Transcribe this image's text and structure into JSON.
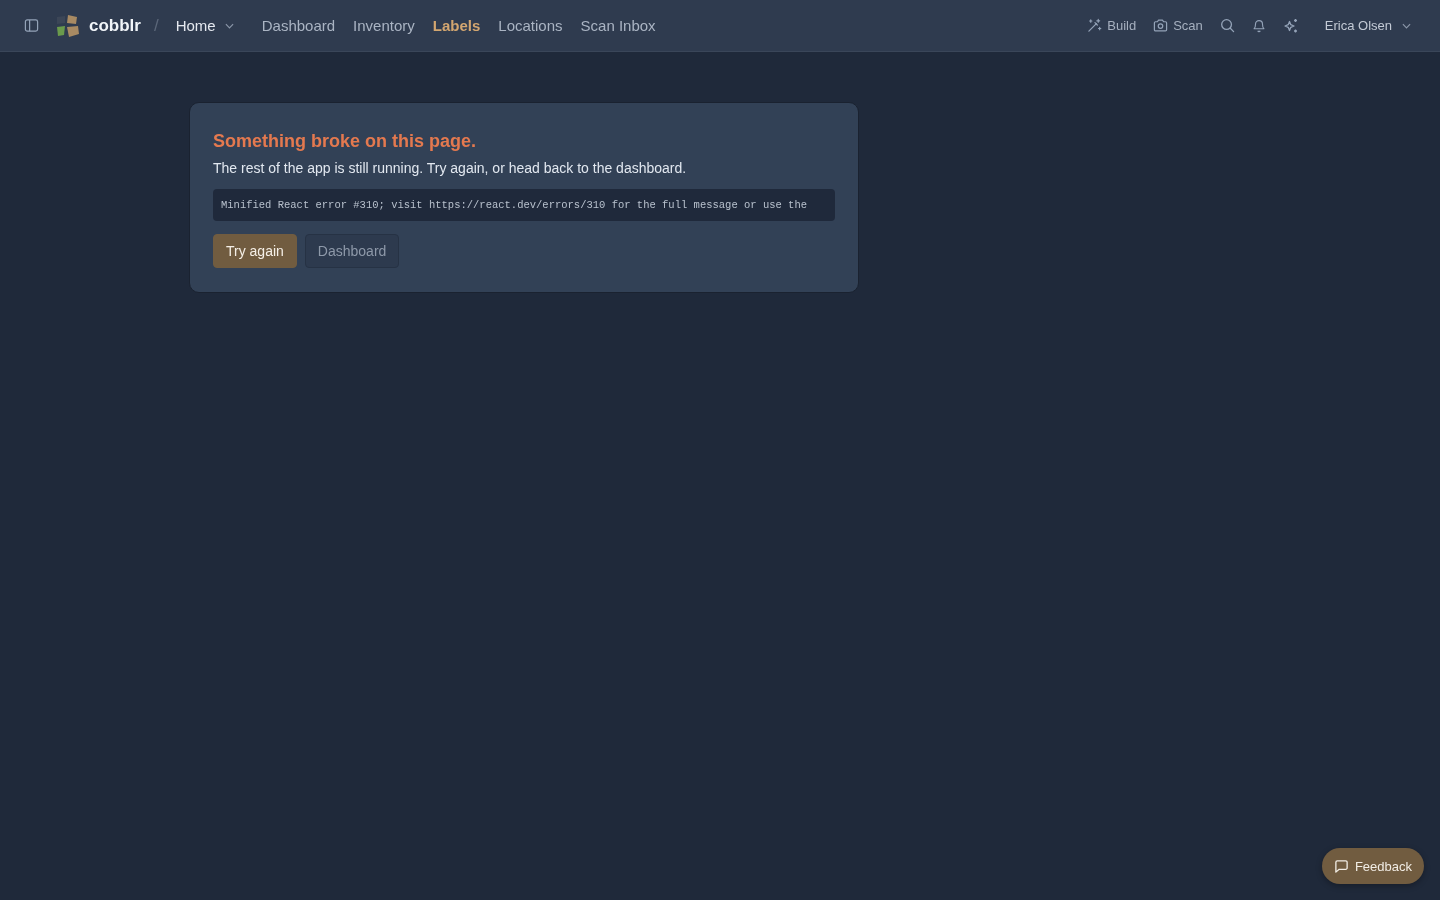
{
  "top_bar": {
    "brand": "cobblr",
    "separator": "/",
    "breadcrumb": {
      "label": "Home"
    },
    "nav": [
      {
        "label": "Dashboard",
        "selected": false
      },
      {
        "label": "Inventory",
        "selected": false
      },
      {
        "label": "Labels",
        "selected": true
      },
      {
        "label": "Locations",
        "selected": false
      },
      {
        "label": "Scan Inbox",
        "selected": false
      }
    ],
    "actions": [
      {
        "kind": "wand",
        "label": "Build"
      },
      {
        "kind": "camera",
        "label": "Scan"
      },
      {
        "kind": "search"
      },
      {
        "kind": "bell"
      },
      {
        "kind": "sparkle"
      }
    ],
    "user": {
      "name": "Erica Olsen"
    }
  },
  "error_card": {
    "title": "Something broke on this page.",
    "message": "The rest of the app is still running. Try again, or head back to the dashboard.",
    "details": "Minified React error #310; visit https://react.dev/errors/310 for the full message or use the",
    "buttons": [
      {
        "kind": "primary",
        "label": "Try again"
      },
      {
        "kind": "secondary",
        "label": "Dashboard"
      }
    ]
  },
  "feedback_button": {
    "label": "Feedback"
  }
}
